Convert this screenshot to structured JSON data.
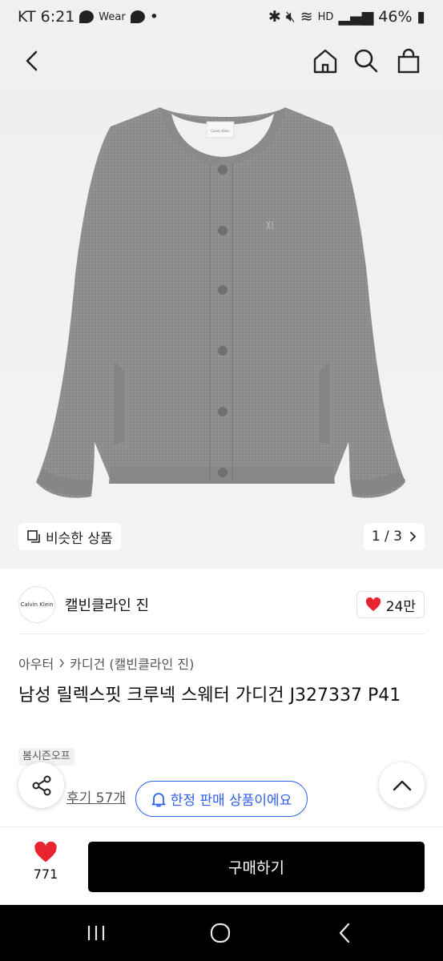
{
  "status": {
    "carrier_time": "KT 6:21",
    "wear_label": "Wear",
    "battery": "46%"
  },
  "product": {
    "similar_label": "비슷한 상품",
    "pager": "1 / 3",
    "brand_logo_text": "Calvin Klein",
    "brand_name": "캘빈클라인 진",
    "likes": "24만",
    "breadcrumb": [
      "아우터",
      "카디건 (캘빈클라인 진)"
    ],
    "title": "남성 릴렉스핏 크루넥 스웨터 가디건 J327337 P41",
    "season_tag": "봄시즌오프",
    "review_link": "후기 57개",
    "limited_notice": "한정 판매 상품이에요",
    "garment_label": "Calvin Klein"
  },
  "bottom_bar": {
    "wish_count": "771",
    "buy_label": "구매하기"
  },
  "colors": {
    "accent": "#2f5fe8",
    "heart": "#e8232f",
    "sweater": "#8f8f8f"
  }
}
